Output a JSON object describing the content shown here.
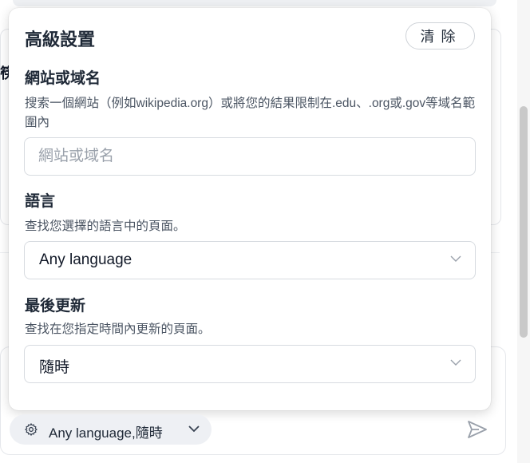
{
  "background": {
    "clipped_heading": "筷"
  },
  "popover": {
    "title": "高級設置",
    "clear_label": "清除",
    "site": {
      "label": "網站或域名",
      "description": "搜索一個網站（例如wikipedia.org）或將您的結果限制在.edu、.org或.gov等域名範圍內",
      "placeholder": "網站或域名",
      "value": ""
    },
    "language": {
      "label": "語言",
      "description": "查找您選擇的語言中的頁面。",
      "selected": "Any language"
    },
    "updated": {
      "label": "最後更新",
      "description": "查找在您指定時間內更新的頁面。",
      "selected": "隨時"
    }
  },
  "filter_chip": {
    "label": "Any language,隨時",
    "icon": "gear-icon"
  },
  "send": {
    "icon": "send-icon"
  },
  "colors": {
    "border": "#d7dbe0",
    "chip_bg": "#eef0f4",
    "muted_text": "#4b5563"
  }
}
